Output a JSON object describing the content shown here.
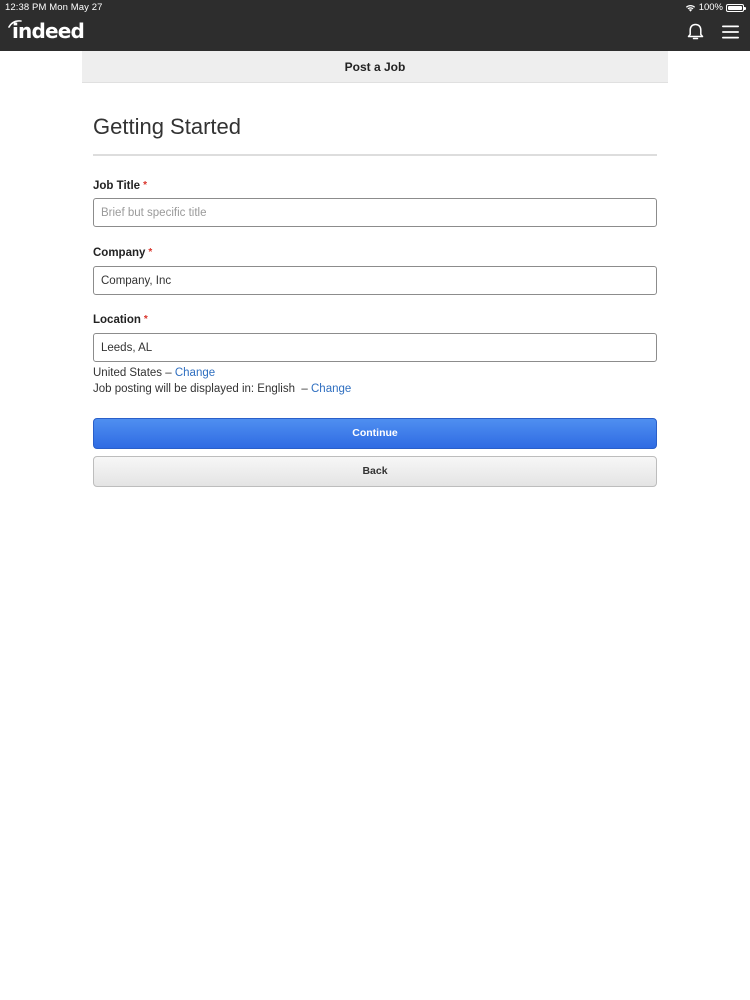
{
  "status_bar": {
    "time_date": "12:38 PM   Mon May 27",
    "battery": "100%"
  },
  "header": {
    "logo": "indeed",
    "icons": [
      "bell-icon",
      "menu-icon"
    ]
  },
  "subheader": {
    "title": "Post a Job"
  },
  "form": {
    "title": "Getting Started",
    "required_marker": "*",
    "job_title": {
      "label": "Job Title",
      "value": "",
      "placeholder": "Brief but specific title"
    },
    "company": {
      "label": "Company",
      "value": "Company, Inc"
    },
    "location": {
      "label": "Location",
      "value": "Leeds, AL"
    },
    "country_text": "United States –",
    "country_change": "Change",
    "language_text": "Job posting will be displayed in: English  –",
    "language_change": "Change",
    "continue_label": "Continue",
    "back_label": "Back"
  },
  "colors": {
    "header_bg": "#2d2d2d",
    "primary_button": "#3a78e8",
    "link": "#2f6fc0",
    "required": "#d9342b"
  }
}
